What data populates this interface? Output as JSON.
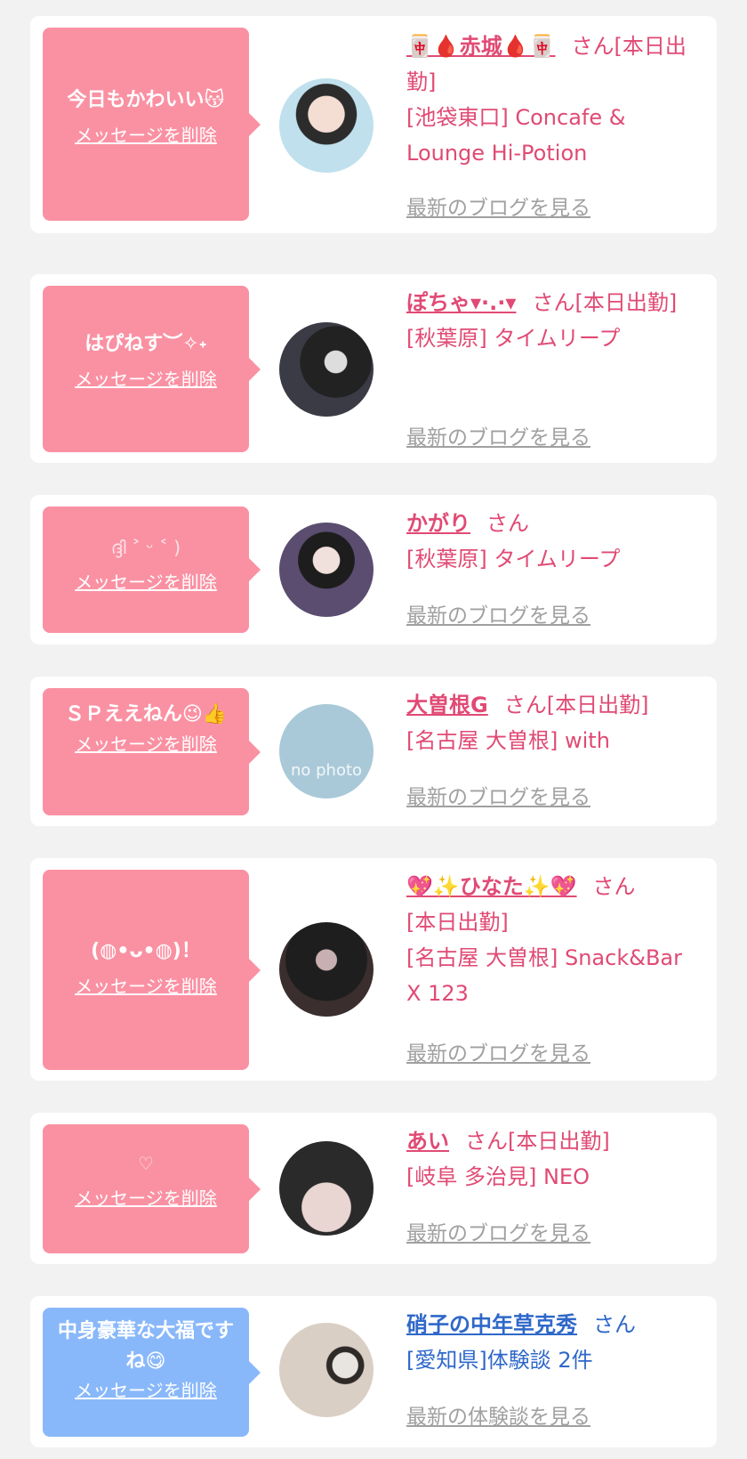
{
  "delete_label": "メッセージを削除",
  "colors": {
    "bubble_pink": "#fa91a3",
    "bubble_blue": "#89b8fa",
    "name_pink": "#e04a74",
    "name_blue": "#2f68c9",
    "link_gray": "#a0a0a0"
  },
  "items": [
    {
      "message": "今日もかわいい😽",
      "name": "🀄🩸赤城🩸🀄",
      "suffix": "さん",
      "status": "[本日出勤]",
      "location": "[池袋東口] Concafe & Lounge Hi-Potion",
      "link": "最新のブログを見る"
    },
    {
      "message": "はぴねす︶✧˖",
      "name": "ぽちゃ▾·.·▾",
      "suffix": "さん",
      "status": "[本日出勤]",
      "location": "[秋葉原] タイムリープ",
      "link": "最新のブログを見る"
    },
    {
      "message": "ദ്ദി ˃ ᵕ ˂ )",
      "name": "かがり",
      "suffix": "さん",
      "status": "",
      "location": "[秋葉原] タイムリープ",
      "link": "最新のブログを見る"
    },
    {
      "message": "ＳＰええねん😉👍",
      "name": "大曽根G",
      "suffix": "さん",
      "status": "[本日出勤]",
      "location": "[名古屋 大曽根] with",
      "link": "最新のブログを見る",
      "avatar_text": "no photo"
    },
    {
      "message": "(◍•ᴗ•◍)！",
      "name": "💖✨ひなた✨💖",
      "suffix": "さん",
      "status": "[本日出勤]",
      "location": "[名古屋 大曽根] Snack&Bar X 123",
      "link": "最新のブログを見る"
    },
    {
      "message": "♡",
      "name": "あい",
      "suffix": "さん",
      "status": "[本日出勤]",
      "location": "[岐阜 多治見] NEO",
      "link": "最新のブログを見る"
    },
    {
      "message": "中身豪華な大福ですね😋",
      "name": "硝子の中年草克秀",
      "suffix": "さん",
      "status": "",
      "location": "[愛知県]体験談 2件",
      "link": "最新の体験談を見る"
    }
  ]
}
